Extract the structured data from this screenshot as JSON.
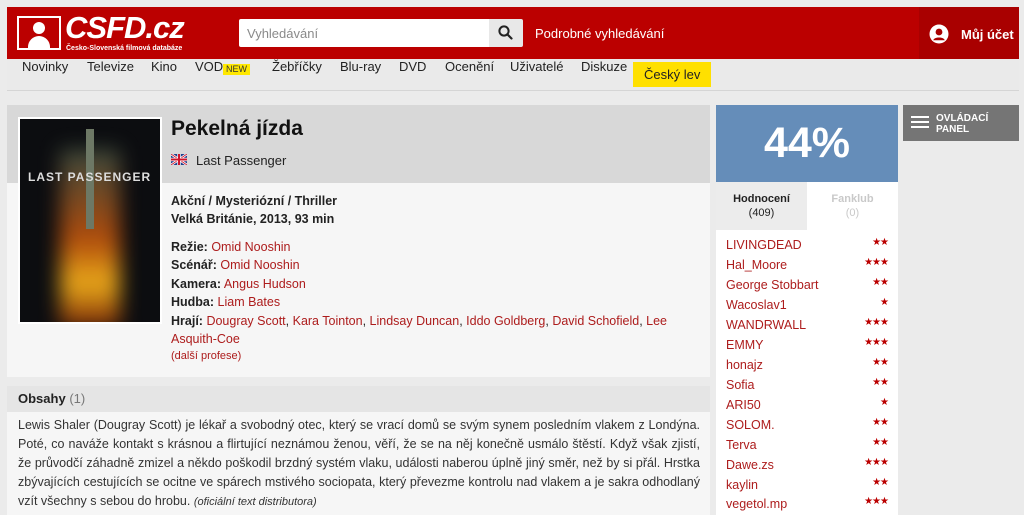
{
  "header": {
    "logo_text": "CSFD.cz",
    "logo_tagline": "Česko-Slovenská filmová databáze",
    "search_placeholder": "Vyhledávání",
    "advanced_search": "Podrobné vyhledávání",
    "account_label": "Můj účet",
    "brand_color": "#bb0000"
  },
  "nav": {
    "items": [
      "Novinky",
      "Televize",
      "Kino",
      "VOD",
      "Žebříčky",
      "Blu-ray",
      "DVD",
      "Ocenění",
      "Uživatelé",
      "Diskuze",
      "Český lev"
    ],
    "new_badge": "NEW"
  },
  "film": {
    "poster_title": "LAST PASSENGER",
    "title": "Pekelná jízda",
    "original_title": "Last Passenger",
    "genres": "Akční / Mysteriózní / Thriller",
    "origin": "Velká Británie, 2013, 93 min",
    "director_label": "Režie:",
    "director": "Omid Nooshin",
    "writer_label": "Scénář:",
    "writer": "Omid Nooshin",
    "camera_label": "Kamera:",
    "camera": "Angus Hudson",
    "music_label": "Hudba:",
    "music": "Liam Bates",
    "cast_label": "Hrají:",
    "cast": [
      "Dougray Scott",
      "Kara Tointon",
      "Lindsay Duncan",
      "Iddo Goldberg",
      "David Schofield",
      "Lee Asquith-Coe"
    ],
    "more_professions": "(další profese)"
  },
  "plot": {
    "heading": "Obsahy",
    "count": "(1)",
    "text": "Lewis Shaler (Dougray Scott) je lékař a svobodný otec, který se vrací domů se svým synem posledním vlakem z Londýna. Poté, co naváže kontakt s krásnou a flirtující neznámou ženou, věří, že se na něj konečně usmálo štěstí. Když však zjistí, že průvodčí záhadně zmizel a někdo poškodil brzdný systém vlaku, události naberou úplně jiný směr, než by si přál. Hrstka zbývajících cestujících se ocitne ve spárech mstivého sociopata, který převezme kontrolu nad vlakem a je sakra odhodlaný vzít všechny s sebou do hrobu.",
    "source": "(oficiální text distributora)"
  },
  "rating": {
    "value": "44%",
    "box_color": "#658db9",
    "tabs": [
      {
        "label": "Hodnocení",
        "count": "(409)"
      },
      {
        "label": "Fanklub",
        "count": "(0)"
      }
    ],
    "list": [
      {
        "user": "LIVINGDEAD",
        "stars": "★★"
      },
      {
        "user": "Hal_Moore",
        "stars": "★★★"
      },
      {
        "user": "George Stobbart",
        "stars": "★★"
      },
      {
        "user": "Wacoslav1",
        "stars": "★"
      },
      {
        "user": "WANDRWALL",
        "stars": "★★★"
      },
      {
        "user": "EMMY",
        "stars": "★★★"
      },
      {
        "user": "honajz",
        "stars": "★★"
      },
      {
        "user": "Sofia",
        "stars": "★★"
      },
      {
        "user": "ARI50",
        "stars": "★"
      },
      {
        "user": "SOLOM.",
        "stars": "★★"
      },
      {
        "user": "Terva",
        "stars": "★★"
      },
      {
        "user": "Dawe.zs",
        "stars": "★★★"
      },
      {
        "user": "kaylin",
        "stars": "★★"
      },
      {
        "user": "vegetol.mp",
        "stars": "★★★"
      }
    ]
  },
  "control_panel": {
    "label": "OVLÁDACÍ PANEL"
  }
}
